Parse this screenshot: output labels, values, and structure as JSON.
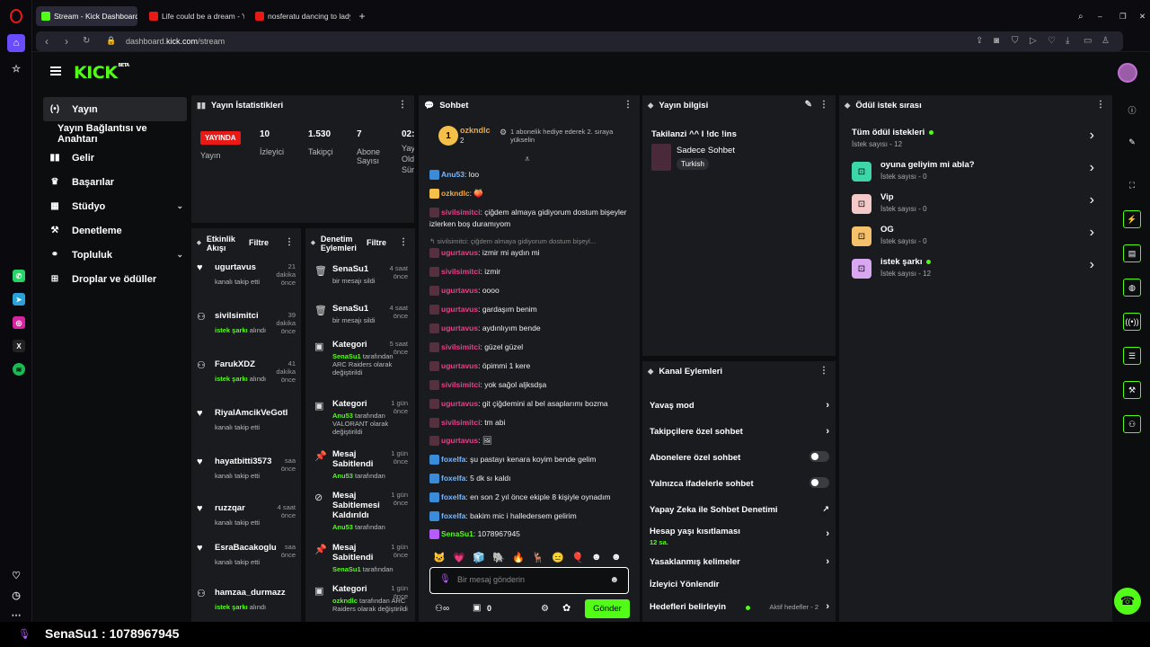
{
  "browser": {
    "tabs": [
      {
        "title": "Stream - Kick Dashboard",
        "color": "#53fc18"
      },
      {
        "title": "Life could be a dream - Yo",
        "color": "#e91916"
      },
      {
        "title": "nosferatu dancing to lady",
        "color": "#e91916"
      }
    ],
    "url_prefix": "dashboard.",
    "url_domain": "kick.com",
    "url_path": "/stream"
  },
  "app": {
    "logo": "KICK",
    "logo_sup": "BETA",
    "nav": [
      {
        "label": "Yayın",
        "icon": "(•)"
      },
      {
        "label": "Yayın Bağlantısı ve Anahtarı",
        "icon": ""
      },
      {
        "label": "Gelir",
        "icon": "▮"
      },
      {
        "label": "Başarılar",
        "icon": "🏆"
      },
      {
        "label": "Stüdyo",
        "icon": "▦"
      },
      {
        "label": "Denetleme",
        "icon": "🔨"
      },
      {
        "label": "Topluluk",
        "icon": "👥"
      },
      {
        "label": "Droplar ve ödüller",
        "icon": "🎁"
      }
    ]
  },
  "stats": {
    "title": "Yayın İstatistikleri",
    "live_badge": "YAYINDA",
    "live_label": "Yayın",
    "viewers_value": "10",
    "viewers_label": "İzleyici",
    "followers_value": "1.530",
    "followers_label": "Takipçi",
    "subs_value": "7",
    "subs_label1": "Abone",
    "subs_label2": "Sayısı",
    "time_value": "02:",
    "time_label1": "Yay",
    "time_label2": "Old",
    "time_label3": "Sür"
  },
  "activity": {
    "title1": "Etkinlik",
    "title2": "Akışı",
    "filter": "Filtre",
    "items": [
      {
        "name": "ugurtavus",
        "time": "21 dakika önce",
        "sub_prefix": "",
        "sub_green": "",
        "sub_text": "kanalı takip etti"
      },
      {
        "name": "sivilsimitci",
        "time": "39 dakika önce",
        "sub_prefix": "",
        "sub_green": "istek şarkı",
        "sub_text": " alındı"
      },
      {
        "name": "FarukXDZ",
        "time": "41 dakika önce",
        "sub_prefix": "",
        "sub_green": "istek şarkı",
        "sub_text": " alındı"
      },
      {
        "name": "RiyalAmcikVeGotl",
        "time": "",
        "sub_prefix": "",
        "sub_green": "",
        "sub_text": "kanalı takip etti"
      },
      {
        "name": "hayatbitti3573",
        "time": "saa önce",
        "sub_prefix": "",
        "sub_green": "",
        "sub_text": "kanalı takip etti"
      },
      {
        "name": "ruzzqar",
        "time": "4 saat önce",
        "sub_prefix": "",
        "sub_green": "",
        "sub_text": "kanalı takip etti"
      },
      {
        "name": "EsraBacakoglu",
        "time": "saa önce",
        "sub_prefix": "",
        "sub_green": "",
        "sub_text": "kanalı takip etti"
      },
      {
        "name": "hamzaa_durmazz",
        "time": "",
        "sub_prefix": "",
        "sub_green": "istek şarkı",
        "sub_text": " alındı"
      }
    ]
  },
  "moderation": {
    "title1": "Denetim",
    "title2": "Eylemleri",
    "filter": "Filtre",
    "items": [
      {
        "name": "SenaSu1",
        "time": "4 saat önce",
        "sub": "bir mesajı sildi",
        "green": ""
      },
      {
        "name": "SenaSu1",
        "time": "4 saat önce",
        "sub": "bir mesajı sildi",
        "green": ""
      },
      {
        "name": "Kategori",
        "time": "5 saat önce",
        "sub": " tarafından ARC Raiders olarak değiştirildi",
        "green": "SenaSu1"
      },
      {
        "name": "Kategori",
        "time": "1 gün önce",
        "sub": " tarafından VALORANT olarak değiştirildi",
        "green": "Anu53"
      },
      {
        "name": "Mesaj Sabitlendi",
        "time": "1 gün önce",
        "sub": " tarafından",
        "green": "Anu53"
      },
      {
        "name": "Mesaj Sabitlemesi Kaldırıldı",
        "time": "1 gün önce",
        "sub": " tarafından",
        "green": "Anu53"
      },
      {
        "name": "Mesaj Sabitlendi",
        "time": "1 gün önce",
        "sub": " tarafından",
        "green": "SenaSu1"
      },
      {
        "name": "Kategori",
        "time": "1 gün önce",
        "sub": " tarafından ARC Raiders olarak değiştirildi",
        "green": "ozkndlc"
      }
    ]
  },
  "chat": {
    "title": "Sohbet",
    "top_gifter": "ozkndlc",
    "top_gifter_count": "2",
    "gift_note": "1 abonelik hediye ederek 2. sıraya yükselin",
    "messages": [
      {
        "user": "Anu53",
        "text": ": loo",
        "color": "#7ab8ff"
      },
      {
        "user": "ozkndlc",
        "text": ": 🍑",
        "color": "#f3a83b"
      },
      {
        "user": "sivilsimitci",
        "text": ": çiğdem almaya gidiyorum dostum bişeyler izlerken boş duramıyom",
        "color": "#e8408a"
      },
      {
        "user": "",
        "text": "↰ sivilsimitci: çiğdem almaya gidiyorum dostum bişeyl...",
        "color": "#888"
      },
      {
        "user": "ugurtavus",
        "text": ": izmir mi aydın mi",
        "color": "#e8408a"
      },
      {
        "user": "sivilsimitci",
        "text": ": izmir",
        "color": "#e8408a"
      },
      {
        "user": "ugurtavus",
        "text": ": oooo",
        "color": "#e8408a"
      },
      {
        "user": "ugurtavus",
        "text": ": gardaşım benim",
        "color": "#e8408a"
      },
      {
        "user": "ugurtavus",
        "text": ": aydınlıyım bende",
        "color": "#e8408a"
      },
      {
        "user": "sivilsimitci",
        "text": ": güzel güzel",
        "color": "#e8408a"
      },
      {
        "user": "ugurtavus",
        "text": ": öpimmi 1 kere",
        "color": "#e8408a"
      },
      {
        "user": "sivilsimitci",
        "text": ": yok sağol aljksdşa",
        "color": "#e8408a"
      },
      {
        "user": "ugurtavus",
        "text": ": git çiğdemini al bel asaplarımı bozma",
        "color": "#e8408a"
      },
      {
        "user": "sivilsimitci",
        "text": ": tm abi",
        "color": "#e8408a"
      },
      {
        "user": "ugurtavus",
        "text": ": 🖼",
        "color": "#e8408a"
      },
      {
        "user": "foxelfa",
        "text": ": şu pastayı kenara koyim bende gelim",
        "color": "#7ab8ff"
      },
      {
        "user": "foxelfa",
        "text": ": 5 dk sı kaldı",
        "color": "#7ab8ff"
      },
      {
        "user": "foxelfa",
        "text": ": en son 2 yıl önce ekiple 8 kişiyle oynadım",
        "color": "#7ab8ff"
      },
      {
        "user": "foxelfa",
        "text": ": bakim mic i halledersem gelirim",
        "color": "#7ab8ff"
      },
      {
        "user": "SenaSu1",
        "text": ": 1078967945",
        "color": "#53fc18"
      }
    ],
    "input_placeholder": "Bir mesaj gönderin",
    "send_label": "Gönder",
    "gift_count": "0"
  },
  "stream_info": {
    "title": "Yayın bilgisi",
    "stream_title": "Takilanzi ^^ I !dc !ins",
    "category": "Sadece Sohbet",
    "tag": "Turkish"
  },
  "channel_actions": {
    "title": "Kanal Eylemleri",
    "items": [
      {
        "label": "Yavaş mod",
        "type": "chev",
        "sub": ""
      },
      {
        "label": "Takipçilere özel sohbet",
        "type": "chev",
        "sub": ""
      },
      {
        "label": "Abonelere özel sohbet",
        "type": "toggle",
        "sub": ""
      },
      {
        "label": "Yalnızca ifadelerle sohbet",
        "type": "toggle",
        "sub": ""
      },
      {
        "label": "Yapay Zeka ile Sohbet Denetimi",
        "type": "ext",
        "sub": ""
      },
      {
        "label": "Hesap yaşı kısıtlaması",
        "type": "chev",
        "sub": "12 sa."
      },
      {
        "label": "Yasaklanmış kelimeler",
        "type": "chev",
        "sub": ""
      },
      {
        "label": "İzleyici Yönlendir",
        "type": "none",
        "sub": ""
      },
      {
        "label": "Hedefleri belirleyin",
        "type": "chev",
        "sub": ""
      }
    ],
    "goals_status": "Aktif hedefler - 2"
  },
  "rewards": {
    "title": "Ödül istek sırası",
    "items": [
      {
        "title": "Tüm ödül istekleri",
        "sub": "İstek sayısı - 12",
        "color": "",
        "dot": true
      },
      {
        "title": "oyuna geliyim mi abla?",
        "sub": "İstek sayısı - 0",
        "color": "#3dd6a9",
        "dot": false
      },
      {
        "title": "Vip",
        "sub": "İstek sayısı - 0",
        "color": "#f4c9c9",
        "dot": false
      },
      {
        "title": "OG",
        "sub": "İstek sayısı - 0",
        "color": "#f5c16b",
        "dot": false
      },
      {
        "title": "istek şarkı",
        "sub": "İstek sayısı - 12",
        "color": "#d9a7f2",
        "dot": true
      }
    ]
  },
  "pinned_bar": "SenaSu1 : 1078967945",
  "colors": {
    "brand": "#53fc18",
    "live": "#e91916"
  }
}
